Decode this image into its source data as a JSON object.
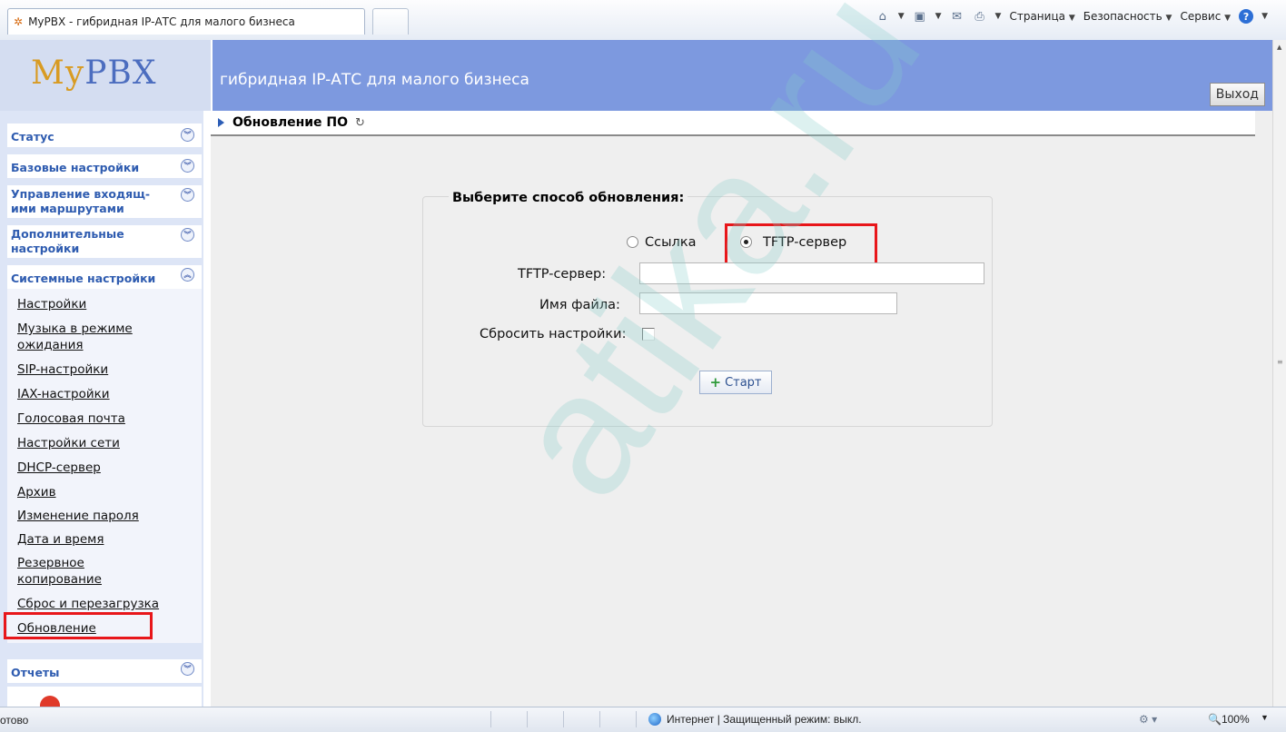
{
  "browser": {
    "tab_title": "MyPBX - гибридная IP-АТС для малого бизнеса",
    "menus": [
      "Страница",
      "Безопасность",
      "Сервис"
    ],
    "status_ready": "отово",
    "status_zone": "Интернет | Защищенный режим: выкл.",
    "zoom": "100%"
  },
  "header": {
    "logo_my": "My",
    "logo_pbx": "PBX",
    "subtitle": "гибридная IP-АТС для малого бизнеса",
    "logout": "Выход"
  },
  "sidebar": {
    "sections": [
      {
        "label": "Статус"
      },
      {
        "label": "Базовые настройки"
      },
      {
        "label_line1": "Управление входящ-",
        "label_line2": "ими маршрутами"
      },
      {
        "label_line1": "Дополнительные",
        "label_line2": "настройки"
      },
      {
        "label": "Системные настройки"
      }
    ],
    "items": [
      {
        "label": "Настройки"
      },
      {
        "label_line1": "Музыка в режиме",
        "label_line2": "ожидания"
      },
      {
        "label": "SIP-настройки"
      },
      {
        "label": "IAX-настройки"
      },
      {
        "label": "Голосовая почта"
      },
      {
        "label": "Настройки сети"
      },
      {
        "label": "DHCP-сервер"
      },
      {
        "label": "Архив"
      },
      {
        "label": "Изменение пароля"
      },
      {
        "label": "Дата и время"
      },
      {
        "label_line1": "Резервное",
        "label_line2": "копирование"
      },
      {
        "label": "Сброс и перезагрузка"
      },
      {
        "label": "Обновление"
      }
    ],
    "reports": "Отчеты"
  },
  "main": {
    "breadcrumb": "Обновление ПО",
    "form": {
      "legend": "Выберите способ обновления:",
      "radio_link": "Ссылка",
      "radio_tftp": "TFTP-сервер",
      "selected_method": "TFTP-сервер",
      "tftp_label": "TFTP-сервер:",
      "tftp_value": "",
      "filename_label": "Имя файла:",
      "filename_value": "",
      "reset_label": "Сбросить настройки:",
      "reset_checked": false,
      "start": "Старт"
    }
  },
  "watermark": "atika.ru",
  "colors": {
    "header_bg": "#7d99df",
    "sidebar_bg": "#dde5f6",
    "highlight": "#e8161a",
    "link_blue": "#2f5cb0"
  }
}
